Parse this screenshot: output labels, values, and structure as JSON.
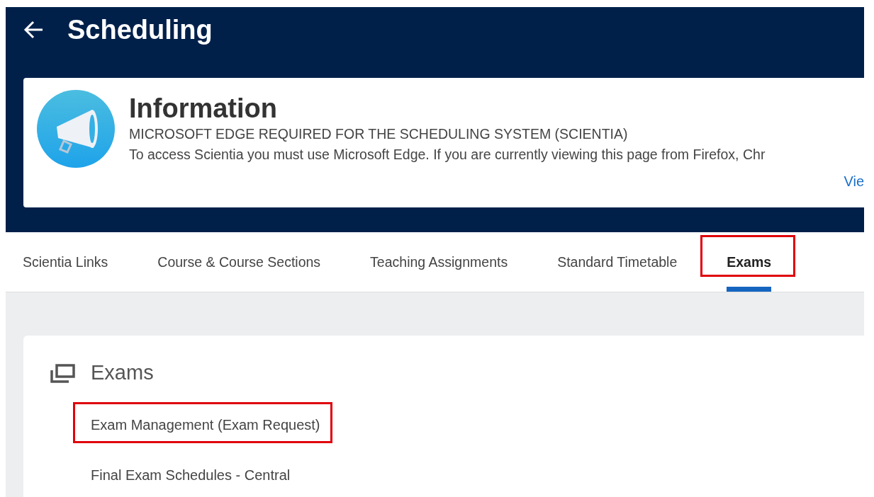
{
  "header": {
    "title": "Scheduling"
  },
  "announcement": {
    "title": "Information",
    "subtitle": "MICROSOFT EDGE REQUIRED FOR THE SCHEDULING SYSTEM (SCIENTIA)",
    "body": "To access Scientia you must use Microsoft Edge. If you are currently viewing this page from Firefox, Chr",
    "link": "Vie"
  },
  "tabs": [
    {
      "label": "Scientia Links",
      "selected": false,
      "highlighted": false
    },
    {
      "label": "Course & Course Sections",
      "selected": false,
      "highlighted": false
    },
    {
      "label": "Teaching Assignments",
      "selected": false,
      "highlighted": false
    },
    {
      "label": "Standard Timetable",
      "selected": false,
      "highlighted": false
    },
    {
      "label": "Exams",
      "selected": true,
      "highlighted": true
    }
  ],
  "section": {
    "title": "Exams",
    "links": [
      {
        "label": "Exam Management (Exam Request)",
        "highlighted": true
      },
      {
        "label": "Final Exam Schedules - Central",
        "highlighted": false
      }
    ]
  }
}
